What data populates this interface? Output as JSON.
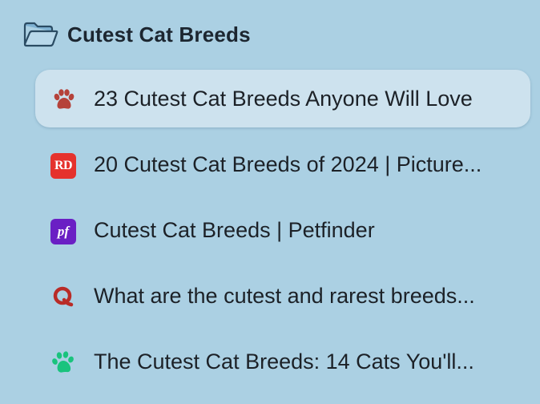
{
  "group": {
    "title": "Cutest Cat Breeds",
    "icon": "folder-open-icon"
  },
  "colors": {
    "background": "#abd0e3",
    "active_tab": "#cde2ee",
    "paw_red": "#b5423a",
    "rd_red": "#e5322d",
    "petfinder_purple": "#6a1fc4",
    "quora_red": "#b92b27",
    "paw_green": "#19c37d"
  },
  "tabs": [
    {
      "title": "23 Cutest Cat Breeds Anyone Will Love",
      "icon": "paw-red-icon",
      "active": true
    },
    {
      "title": "20 Cutest Cat Breeds of 2024 | Picture...",
      "icon": "readers-digest-icon",
      "badge": "RD",
      "active": false
    },
    {
      "title": "Cutest Cat Breeds | Petfinder",
      "icon": "petfinder-icon",
      "badge": "pf",
      "active": false
    },
    {
      "title": "What are the cutest and rarest breeds...",
      "icon": "quora-icon",
      "active": false
    },
    {
      "title": "The Cutest Cat Breeds: 14 Cats You'll...",
      "icon": "paw-green-icon",
      "active": false
    }
  ]
}
